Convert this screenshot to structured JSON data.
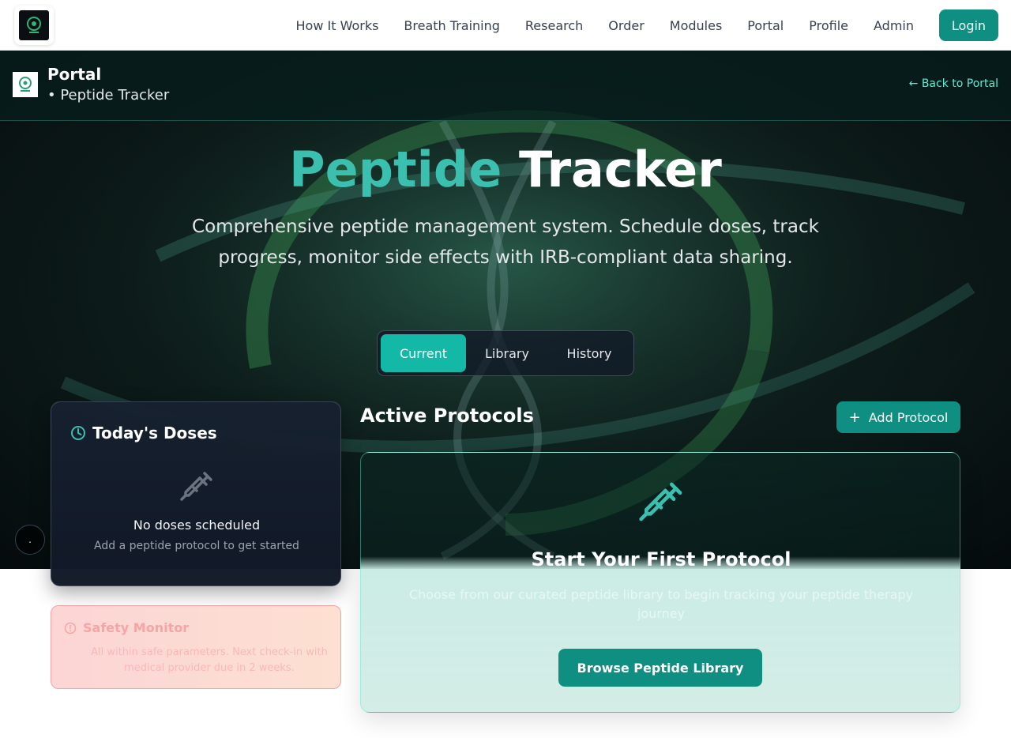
{
  "nav": {
    "links": [
      "How It Works",
      "Breath Training",
      "Research",
      "Order",
      "Modules",
      "Portal",
      "Profile",
      "Admin"
    ],
    "login_label": "Login"
  },
  "portal": {
    "title": "Portal",
    "subtitle": "• Peptide Tracker",
    "back_link": "← Back to Portal"
  },
  "hero": {
    "title_accent": "Peptide",
    "title_rest": "Tracker",
    "description": "Comprehensive peptide management system. Schedule doses, track progress, monitor side effects with IRB-compliant data sharing."
  },
  "tabs": [
    {
      "label": "Current",
      "active": true
    },
    {
      "label": "Library",
      "active": false
    },
    {
      "label": "History",
      "active": false
    }
  ],
  "doses": {
    "title": "Today's Doses",
    "empty_title": "No doses scheduled",
    "empty_subtitle": "Add a peptide protocol to get started"
  },
  "safety": {
    "title": "Safety Monitor",
    "body": "All within safe parameters. Next check-in with medical provider due in 2 weeks."
  },
  "protocols": {
    "title": "Active Protocols",
    "add_label": "Add Protocol",
    "empty_title": "Start Your First Protocol",
    "empty_desc": "Choose from our curated peptide library to begin tracking your peptide therapy journey",
    "browse_label": "Browse Peptide Library"
  },
  "colors": {
    "accent": "#14b8a6",
    "button": "#0f8f82",
    "title_accent": "#3bbfae",
    "safety_bg": "#fcd5d5"
  },
  "icons": [
    "clock-icon",
    "syringe-icon",
    "plus-icon",
    "alert-icon"
  ]
}
